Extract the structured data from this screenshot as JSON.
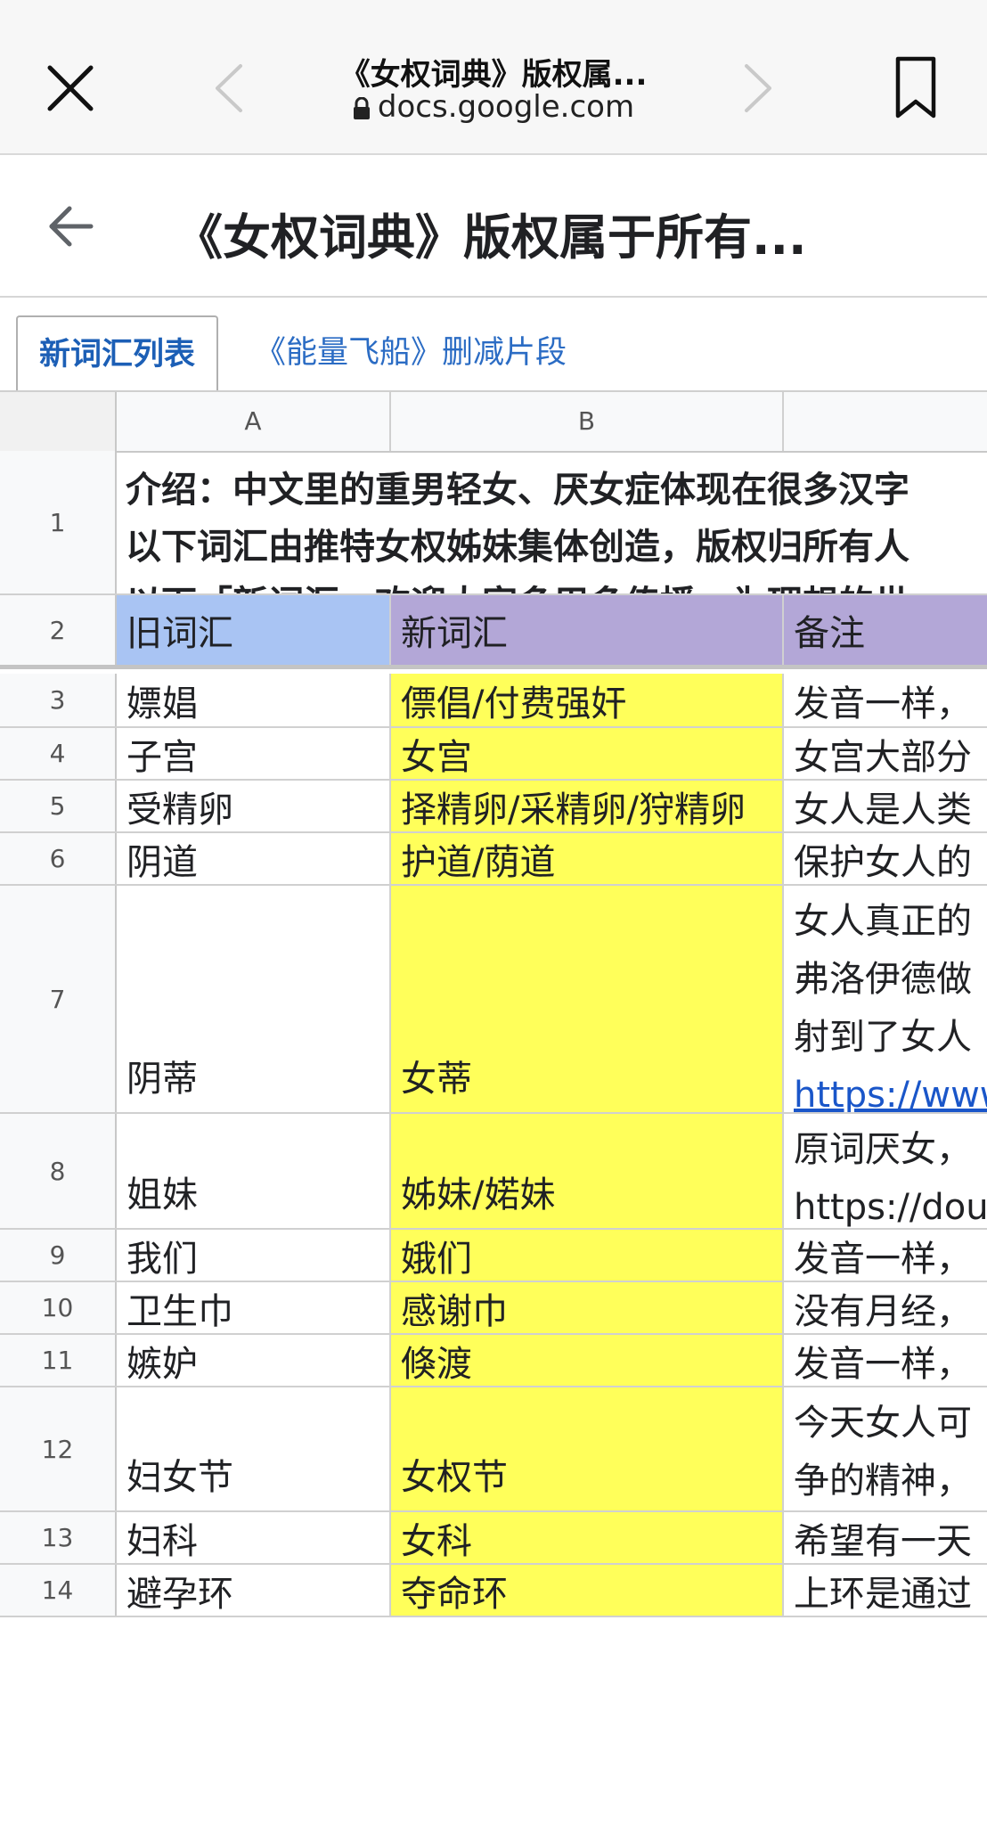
{
  "browser": {
    "page_title": "《女权词典》版权属...",
    "url": "docs.google.com"
  },
  "doc": {
    "title": "《女权词典》版权属于所有..."
  },
  "tabs": [
    {
      "label": "新词汇列表",
      "active": true
    },
    {
      "label": "《能量飞船》删减片段",
      "active": false
    }
  ],
  "columns": [
    "A",
    "B"
  ],
  "intro_lines": [
    "介绍：中文里的重男轻女、厌女症体现在很多汉字",
    "以下词汇由推特女权姊妹集体创造，版权归所有人",
    "以下「新词汇」欢迎大家多用多传播，为理想的世"
  ],
  "header_row": {
    "num": "2",
    "old": "旧词汇",
    "new": "新词汇",
    "note": "备注"
  },
  "rows": [
    {
      "num": "3",
      "old": "嫖娼",
      "new": "僄倡/付费强奸",
      "note": [
        "发音一样，"
      ]
    },
    {
      "num": "4",
      "old": "子宫",
      "new": "女宫",
      "note": [
        "女宫大部分"
      ]
    },
    {
      "num": "5",
      "old": "受精卵",
      "new": "择精卵/采精卵/狩精卵",
      "note": [
        "女人是人类"
      ]
    },
    {
      "num": "6",
      "old": "阴道",
      "new": "护道/荫道",
      "note": [
        "保护女人的"
      ]
    },
    {
      "num": "7",
      "old": "阴蒂",
      "new": "女蒂",
      "note": [
        "女人真正的",
        "弗洛伊德做",
        "射到了女人",
        "https://www"
      ]
    },
    {
      "num": "8",
      "old": "姐妹",
      "new": "姊妹/婼妹",
      "note": [
        "原词厌女，",
        "https://doub"
      ]
    },
    {
      "num": "9",
      "old": "我们",
      "new": "娥们",
      "note": [
        "发音一样，"
      ]
    },
    {
      "num": "10",
      "old": "卫生巾",
      "new": "感谢巾",
      "note": [
        "没有月经，"
      ]
    },
    {
      "num": "11",
      "old": "嫉妒",
      "new": "倏渡",
      "note": [
        "发音一样，"
      ]
    },
    {
      "num": "12",
      "old": "妇女节",
      "new": "女权节",
      "note": [
        "今天女人可",
        "争的精神，"
      ]
    },
    {
      "num": "13",
      "old": "妇科",
      "new": "女科",
      "note": [
        "希望有一天"
      ]
    },
    {
      "num": "14",
      "old": "避孕环",
      "new": "夺命环",
      "note": [
        "上环是通过"
      ]
    }
  ],
  "colors": {
    "highlight_yellow": "#ffff5a",
    "header_blue": "#a9c4f3",
    "header_purple": "#b3a7d7",
    "link_blue": "#1a56c9"
  }
}
